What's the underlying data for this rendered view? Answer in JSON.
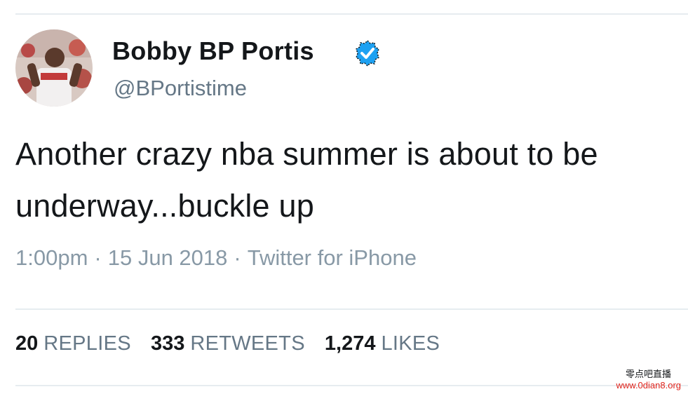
{
  "tweet": {
    "author_name": "Bobby BP Portis",
    "handle": "@BPortistime",
    "verified_icon": "verified-badge-icon",
    "text": "Another crazy nba summer is about to be underway...buckle up",
    "time": "1:00pm",
    "date": "15 Jun 2018",
    "source": "Twitter for iPhone",
    "separator": "·"
  },
  "stats": {
    "replies_count": "20",
    "replies_label": "REPLIES",
    "retweets_count": "333",
    "retweets_label": "RETWEETS",
    "likes_count": "1,274",
    "likes_label": "LIKES"
  },
  "watermark": {
    "chinese": "零点吧直播",
    "url": "www.0dian8.org"
  },
  "colors": {
    "text": "#14171a",
    "secondary": "#657786",
    "meta": "#8899a6",
    "verified": "#1da1f2",
    "divider": "#e6ecf0",
    "watermark_url": "#e0241c"
  }
}
